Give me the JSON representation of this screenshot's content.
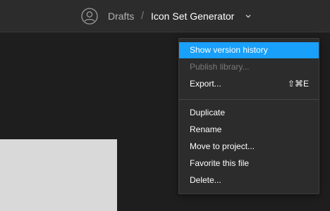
{
  "header": {
    "avatar_icon": "user-circle-icon",
    "breadcrumb_root": "Drafts",
    "breadcrumb_separator": "/",
    "file_name": "Icon Set Generator",
    "dropdown_icon": "chevron-down-icon"
  },
  "menu": {
    "items_top": [
      {
        "label": "Show version history",
        "state": "highlighted"
      },
      {
        "label": "Publish library...",
        "state": "disabled"
      },
      {
        "label": "Export...",
        "shortcut": "⇧⌘E",
        "state": "normal"
      }
    ],
    "items_bottom": [
      {
        "label": "Duplicate"
      },
      {
        "label": "Rename"
      },
      {
        "label": "Move to project..."
      },
      {
        "label": "Favorite this file"
      },
      {
        "label": "Delete..."
      }
    ]
  },
  "colors": {
    "accent": "#18a0fb",
    "background": "#1e1e1e",
    "toolbar": "#2c2c2c",
    "frame": "#d9d9d9"
  }
}
